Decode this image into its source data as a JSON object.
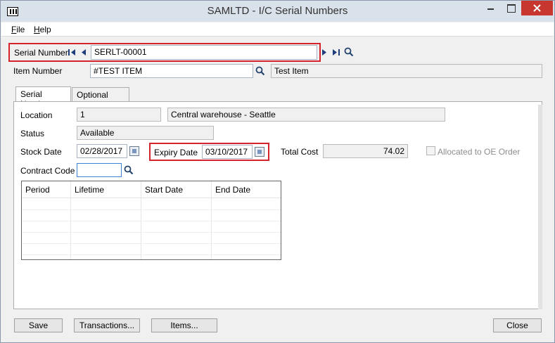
{
  "window": {
    "title": "SAMLTD - I/C Serial Numbers"
  },
  "menu": {
    "file": {
      "label": "File",
      "underline": "F",
      "rest": "ile"
    },
    "help": {
      "label": "Help",
      "underline": "H",
      "rest": "elp"
    }
  },
  "header": {
    "serial_label": "Serial Number",
    "serial_value": "SERLT-00001",
    "item_label": "Item Number",
    "item_value": "#TEST ITEM",
    "item_description": "Test Item"
  },
  "tabs": [
    {
      "label": "Serial Number",
      "underline": "N"
    },
    {
      "label": "Optional Fields",
      "underline": "O"
    }
  ],
  "details": {
    "location_label": "Location",
    "location_code": "1",
    "location_name": "Central warehouse - Seattle",
    "status_label": "Status",
    "status_value": "Available",
    "stock_date_label": "Stock Date",
    "stock_date_value": "02/28/2017",
    "expiry_date_label": "Expiry Date",
    "expiry_date_value": "03/10/2017",
    "total_cost_label": "Total Cost",
    "total_cost_value": "74.02",
    "allocated_label": "Allocated to OE Order",
    "allocated_checked": false,
    "contract_code_label": "Contract Code",
    "contract_code_value": ""
  },
  "grid": {
    "columns": [
      "Period",
      "Lifetime",
      "Start Date",
      "End Date"
    ],
    "rows": []
  },
  "buttons": {
    "save": "Save",
    "transactions": "Transactions...",
    "items": "Items...",
    "close": "Close"
  },
  "colors": {
    "highlight": "#d5232d",
    "nav_arrow": "#1f3d7a"
  }
}
